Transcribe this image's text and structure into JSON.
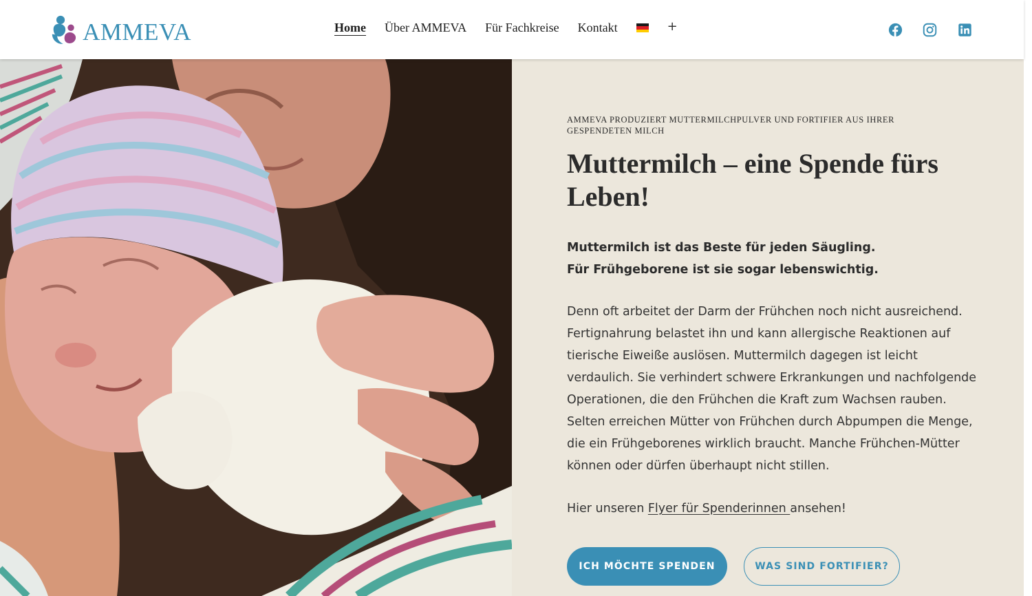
{
  "brand": {
    "name": "AMMEVA",
    "accent_color": "#3a8fb5",
    "logo_secondary_color": "#9c4a8c"
  },
  "nav": {
    "items": [
      {
        "label": "Home",
        "active": true
      },
      {
        "label": "Über AMMEVA",
        "active": false
      },
      {
        "label": "Für Fachkreise",
        "active": false
      },
      {
        "label": "Kontakt",
        "active": false
      }
    ],
    "language_flag": "german-flag-icon",
    "more_symbol": "+"
  },
  "social": [
    {
      "icon": "facebook-icon"
    },
    {
      "icon": "instagram-icon"
    },
    {
      "icon": "linkedin-icon"
    }
  ],
  "hero": {
    "image_description_icon": "mother-holding-newborn-photo",
    "background_color": "#ece7dc",
    "eyebrow": "AMMEVA produziert Muttermilchpulver und Fortifier aus Ihrer gespendeten Milch",
    "headline": "Muttermilch – eine Spende fürs Leben!",
    "lead_line1": "Muttermilch ist das Beste für jeden Säugling.",
    "lead_line2": "Für Frühgeborene ist sie sogar lebenswichtig.",
    "body": "Denn oft arbeitet der Darm der Frühchen noch nicht ausreichend. Fertignahrung belastet ihn und kann allergische Reaktionen auf tierische Eiweiße auslösen. Muttermilch dagegen ist leicht verdaulich. Sie verhindert schwere Erkrankungen und nachfolgende Operationen, die den Frühchen die Kraft zum Wachsen rauben. Selten erreichen Mütter von Frühchen durch Abpumpen die Menge, die ein Frühgeborenes wirklich braucht. Manche Frühchen-Mütter können oder dürfen überhaupt nicht stillen.",
    "flyer_prefix": "Hier unseren ",
    "flyer_link": "Flyer für Spenderinnen ",
    "flyer_suffix": "ansehen!",
    "primary_button": "Ich möchte spenden",
    "secondary_button": "Was sind Fortifier?"
  }
}
